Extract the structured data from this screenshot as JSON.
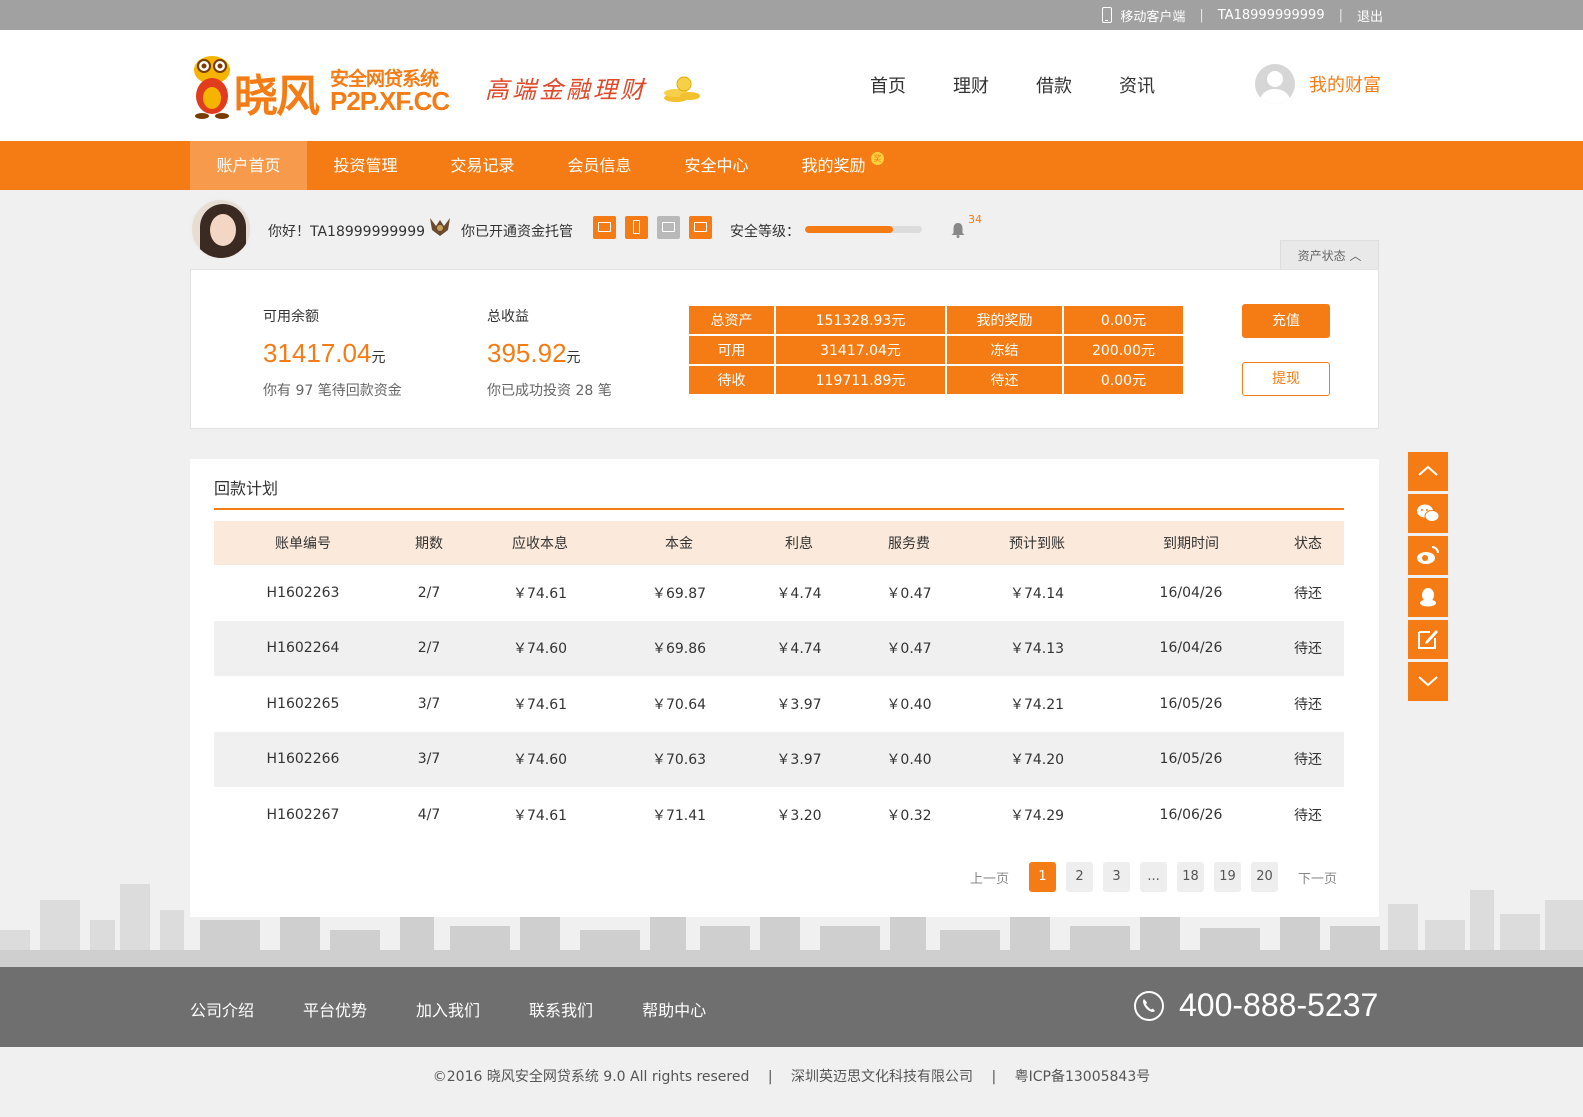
{
  "topbar": {
    "mobile_client": "移动客户端",
    "account": "TA18999999999",
    "logout": "退出"
  },
  "header": {
    "logo_main": "晓风",
    "logo_sub": "安全网贷系统",
    "logo_url": "P2P.XF.CC",
    "slogan": "高端金融理财",
    "nav": [
      "首页",
      "理财",
      "借款",
      "资讯"
    ],
    "my_wealth": "我的财富"
  },
  "subnav": [
    "账户首页",
    "投资管理",
    "交易记录",
    "会员信息",
    "安全中心",
    "我的奖励"
  ],
  "subnav_badge": "奖",
  "user": {
    "greeting": "你好！TA18999999999",
    "custody": "你已开通资金托管",
    "security_label": "安全等级：",
    "security_level": 0.75,
    "bell_count": "34",
    "asset_status": "资产状态"
  },
  "assets": {
    "available": {
      "title": "可用余额",
      "value": "31417.04",
      "unit": "元",
      "note": "你有 97 笔待回款资金"
    },
    "income": {
      "title": "总收益",
      "value": "395.92",
      "unit": "元",
      "note": "你已成功投资 28 笔"
    },
    "table": [
      [
        "总资产",
        "151328.93元",
        "我的奖励",
        "0.00元"
      ],
      [
        "可用",
        "31417.04元",
        "冻结",
        "200.00元"
      ],
      [
        "待收",
        "119711.89元",
        "待还",
        "0.00元"
      ]
    ],
    "recharge": "充值",
    "withdraw": "提现"
  },
  "plan": {
    "title": "回款计划",
    "headers": [
      "账单编号",
      "期数",
      "应收本息",
      "本金",
      "利息",
      "服务费",
      "预计到账",
      "到期时间",
      "状态"
    ],
    "rows": [
      [
        "H1602263",
        "2/7",
        "￥74.61",
        "￥69.87",
        "￥4.74",
        "￥0.47",
        "￥74.14",
        "16/04/26",
        "待还"
      ],
      [
        "H1602264",
        "2/7",
        "￥74.60",
        "￥69.86",
        "￥4.74",
        "￥0.47",
        "￥74.13",
        "16/04/26",
        "待还"
      ],
      [
        "H1602265",
        "3/7",
        "￥74.61",
        "￥70.64",
        "￥3.97",
        "￥0.40",
        "￥74.21",
        "16/05/26",
        "待还"
      ],
      [
        "H1602266",
        "3/7",
        "￥74.60",
        "￥70.63",
        "￥3.97",
        "￥0.40",
        "￥74.20",
        "16/05/26",
        "待还"
      ],
      [
        "H1602267",
        "4/7",
        "￥74.61",
        "￥71.41",
        "￥3.20",
        "￥0.32",
        "￥74.29",
        "16/06/26",
        "待还"
      ]
    ],
    "pager": {
      "prev": "上一页",
      "next": "下一页",
      "pages": [
        "1",
        "2",
        "3",
        "...",
        "18",
        "19",
        "20"
      ],
      "current": "1"
    }
  },
  "footer": {
    "links": [
      "公司介绍",
      "平台优势",
      "加入我们",
      "联系我们",
      "帮助中心"
    ],
    "phone": "400-888-5237",
    "copyright": "©2016 晓风安全网贷系统 9.0  All rights resered",
    "company": "深圳英迈思文化科技有限公司",
    "icp": "粤ICP备13005843号"
  },
  "colors": {
    "accent": "#f57c14",
    "accent_light": "#f89a4c",
    "header_row": "#fbeadb",
    "footer": "#6f6f6f"
  }
}
